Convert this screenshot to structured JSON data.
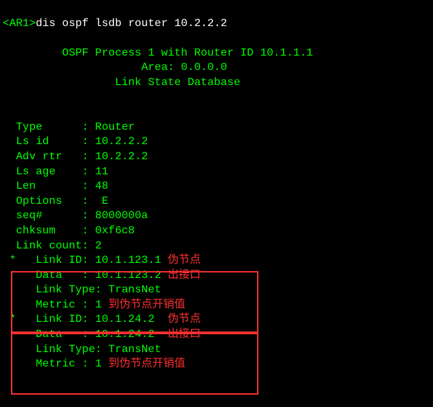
{
  "prompt": "<AR1>",
  "command": "dis ospf lsdb router 10.2.2.2",
  "header1": "OSPF Process 1 with Router ID 10.1.1.1",
  "header2": "Area: 0.0.0.0",
  "header3": "Link State Database",
  "fields": {
    "type": {
      "label": "Type      ",
      "value": "Router"
    },
    "lsid": {
      "label": "Ls id     ",
      "value": "10.2.2.2"
    },
    "advrtr": {
      "label": "Adv rtr   ",
      "value": "10.2.2.2"
    },
    "lsage": {
      "label": "Ls age    ",
      "value": "11"
    },
    "len": {
      "label": "Len       ",
      "value": "48"
    },
    "options": {
      "label": "Options   ",
      "value": " E"
    },
    "seq": {
      "label": "seq#      ",
      "value": "8000000a"
    },
    "chksum": {
      "label": "chksum    ",
      "value": "0xf6c8"
    },
    "linkcount": {
      "label": "Link count",
      "value": "2"
    }
  },
  "links": [
    {
      "linkid": {
        "label": "   Link ID: ",
        "value": "10.1.123.1"
      },
      "data": {
        "label": "   Data   : ",
        "value": "10.1.123.2"
      },
      "linktype": {
        "label": "   Link Type: ",
        "value": "TransNet"
      },
      "metric": {
        "label": "   Metric : ",
        "value": "1"
      },
      "annot_linkid": "伪节点",
      "annot_data": "出接口",
      "annot_metric": "到伪节点开销值"
    },
    {
      "linkid": {
        "label": "   Link ID: ",
        "value": "10.1.24.2"
      },
      "data": {
        "label": "   Data   : ",
        "value": "10.1.24.2"
      },
      "linktype": {
        "label": "   Link Type: ",
        "value": "TransNet"
      },
      "metric": {
        "label": "   Metric : ",
        "value": "1"
      },
      "annot_linkid": "伪节点",
      "annot_data": "出接口",
      "annot_metric": "到伪节点开销值"
    }
  ],
  "annot_color": "#ff3030"
}
